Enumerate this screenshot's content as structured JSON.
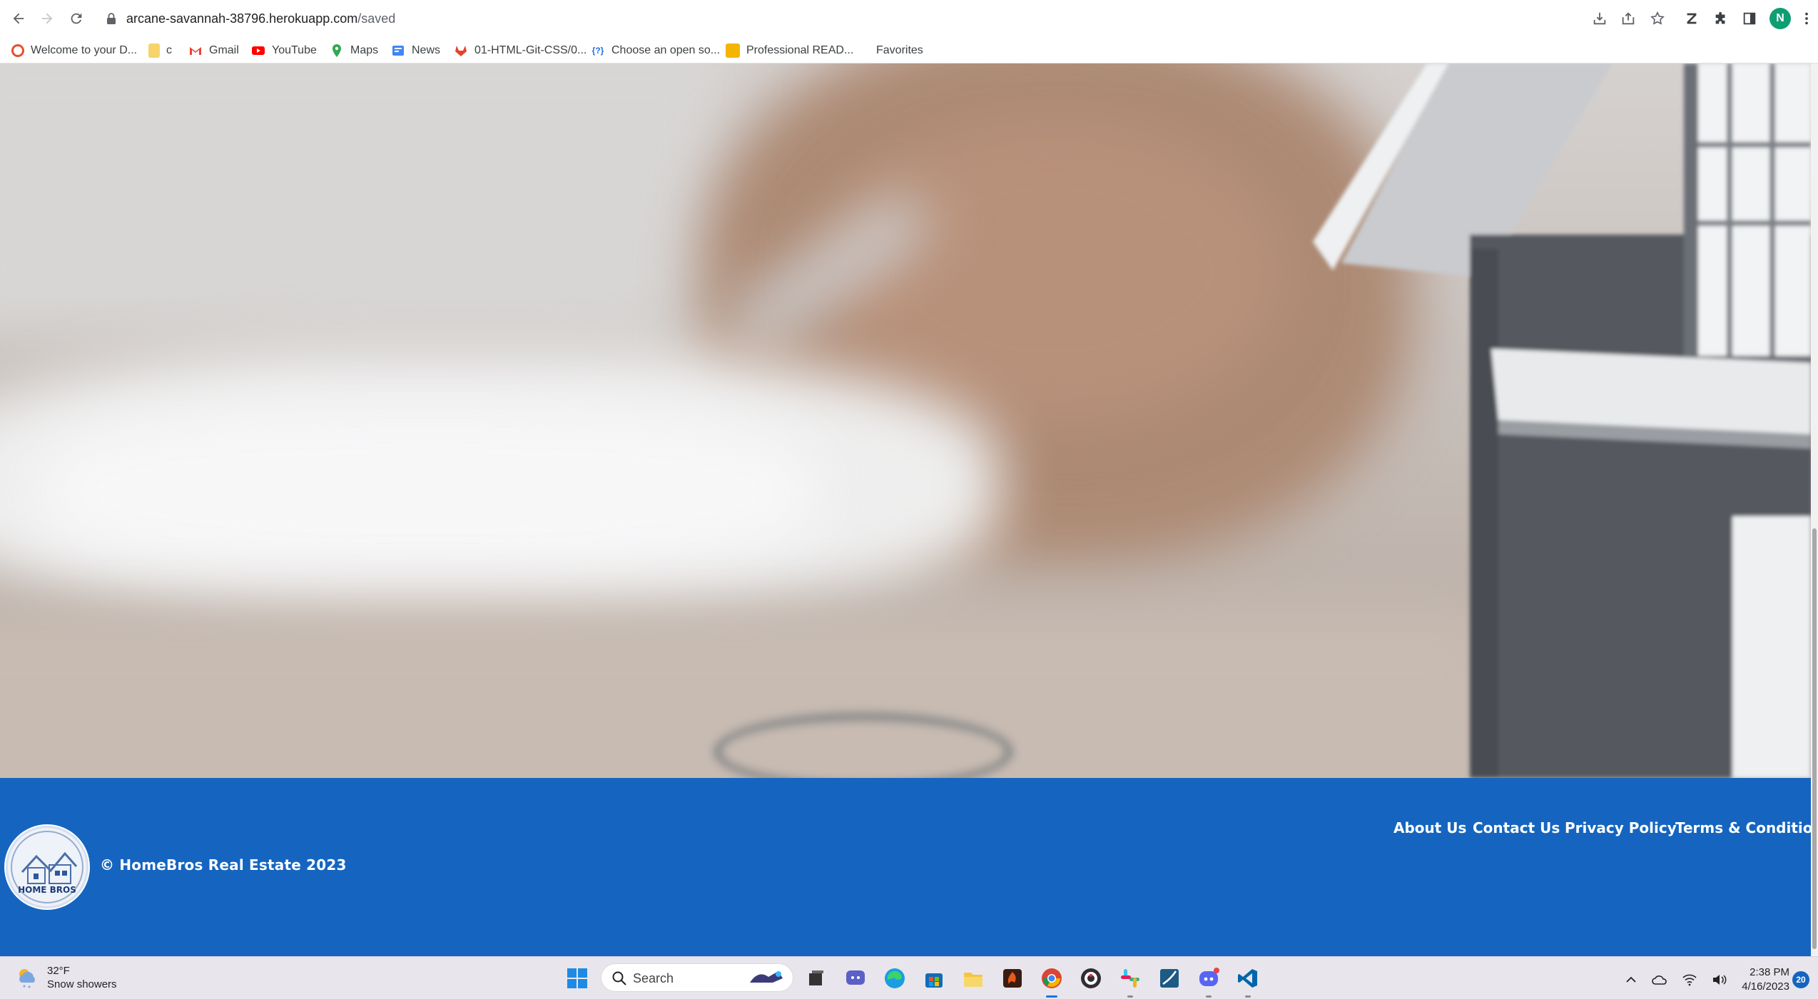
{
  "browser": {
    "url_host": "arcane-savannah-38796.herokuapp.com",
    "url_path": "/saved",
    "profile_initial": "N"
  },
  "bookmarks": [
    {
      "label": "Welcome to your D...",
      "icon": "chrome-g-icon",
      "color": "#e2522f"
    },
    {
      "label": "c",
      "icon": "folder-icon",
      "color": "#f6d36b"
    },
    {
      "label": "Gmail",
      "icon": "gmail-icon",
      "color": "#ea4335"
    },
    {
      "label": "YouTube",
      "icon": "youtube-icon",
      "color": "#ff0000"
    },
    {
      "label": "Maps",
      "icon": "maps-icon",
      "color": "#34a853"
    },
    {
      "label": "News",
      "icon": "news-icon",
      "color": "#4285f4"
    },
    {
      "label": "01-HTML-Git-CSS/0...",
      "icon": "gitlab-icon",
      "color": "#e24329"
    },
    {
      "label": "Choose an open so...",
      "icon": "choosealicense-icon",
      "color": "#1a73e8"
    },
    {
      "label": "Professional READ...",
      "icon": "readme-icon",
      "color": "#f4b400"
    },
    {
      "label": "Favorites",
      "icon": "none",
      "color": "#ffffff"
    }
  ],
  "footer": {
    "copyright": "© HomeBros Real Estate 2023",
    "logo_text": "HOME BROS",
    "links": [
      "About Us",
      "Contact Us",
      "Privacy Policy",
      "Terms & Conditions"
    ],
    "background": "#1565c0"
  },
  "taskbar": {
    "weather_temp": "32°F",
    "weather_desc": "Snow showers",
    "search_label": "Search",
    "time": "2:38 PM",
    "date": "4/16/2023",
    "notification_count": "20",
    "apps": [
      "windows-start-icon",
      "task-view-icon",
      "teams-chat-icon",
      "edge-icon",
      "ms-store-icon",
      "file-explorer-icon",
      "game-icon",
      "chrome-icon",
      "obs-icon",
      "slack-icon",
      "mysql-workbench-icon",
      "discord-icon",
      "vscode-icon"
    ]
  }
}
